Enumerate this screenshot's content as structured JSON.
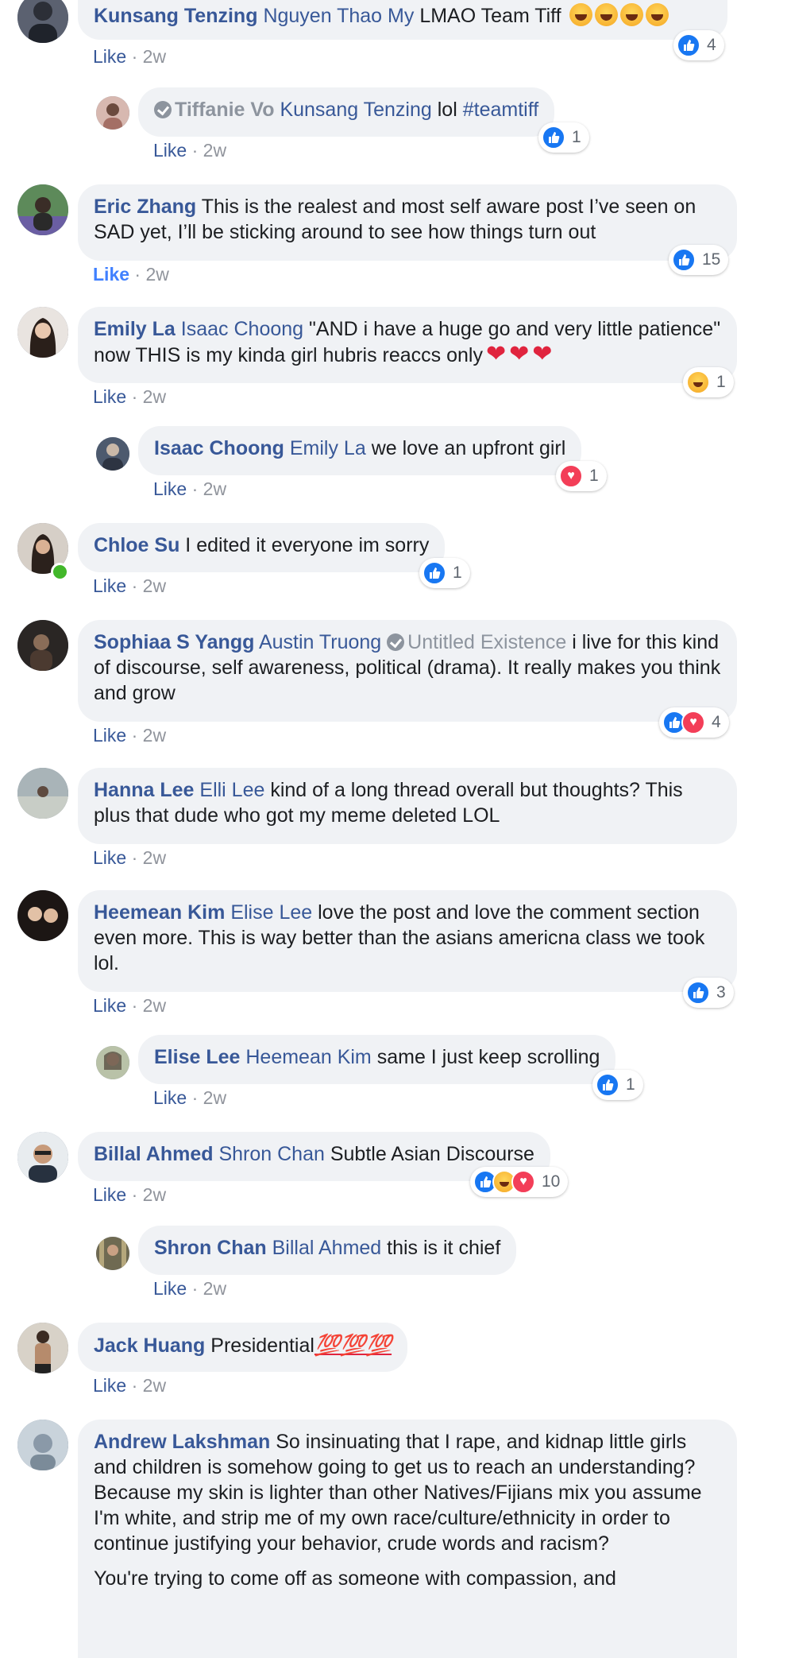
{
  "comments": [
    {
      "id": "c1",
      "author": "Kunsang Tenzing",
      "mention": "Nguyen Thao My",
      "text": "LMAO Team Tiff",
      "emoji_count": 4,
      "like_label": "Like",
      "sep": "·",
      "time": "2w",
      "reaction_count": "4",
      "reactions": [
        "like"
      ],
      "replies": [
        {
          "id": "r1",
          "muted_author": "Tiffanie Vo",
          "mention": "Kunsang Tenzing",
          "text": "lol",
          "hashtag": "#teamtiff",
          "like_label": "Like",
          "sep": "·",
          "time": "2w",
          "reaction_count": "1",
          "reactions": [
            "like"
          ]
        }
      ]
    },
    {
      "id": "c2",
      "author": "Eric Zhang",
      "text": "This is the realest and most self aware post I’ve seen on SAD yet, I’ll be sticking around to see how things turn out",
      "like_label": "Like",
      "like_active": true,
      "sep": "·",
      "time": "2w",
      "reaction_count": "15",
      "reactions": [
        "like"
      ]
    },
    {
      "id": "c3",
      "author": "Emily La",
      "mention": "Isaac Choong",
      "text": "\"AND i have a huge go and very little patience\" now THIS is my kinda girl hubris reaccs only",
      "like_label": "Like",
      "sep": "·",
      "time": "2w",
      "reaction_count": "1",
      "reactions": [
        "haha"
      ],
      "replies": [
        {
          "id": "r2",
          "author": "Isaac Choong",
          "mention": "Emily La",
          "text": "we love an upfront girl",
          "like_label": "Like",
          "sep": "·",
          "time": "2w",
          "reaction_count": "1",
          "reactions": [
            "love"
          ]
        }
      ]
    },
    {
      "id": "c4",
      "author": "Chloe Su",
      "text": "I edited it everyone im sorry",
      "online": true,
      "like_label": "Like",
      "sep": "·",
      "time": "2w",
      "reaction_count": "1",
      "reactions": [
        "like"
      ]
    },
    {
      "id": "c5",
      "author": "Sophiaa S Yangg",
      "mention": "Austin Truong",
      "muted_page": "Untitled Existence",
      "text": "i live for this kind of discourse, self awareness, political (drama). It really makes you think and grow",
      "like_label": "Like",
      "sep": "·",
      "time": "2w",
      "reaction_count": "4",
      "reactions": [
        "like",
        "love"
      ]
    },
    {
      "id": "c6",
      "author": "Hanna Lee",
      "mention": "Elli Lee",
      "text": "kind of a long thread overall but thoughts? This plus that dude who got my meme deleted LOL",
      "like_label": "Like",
      "sep": "·",
      "time": "2w"
    },
    {
      "id": "c7",
      "author": "Heemean Kim",
      "mention": "Elise Lee",
      "text": "love the post and love the comment section even more. This is way better than the asians americna class we took lol.",
      "like_label": "Like",
      "sep": "·",
      "time": "2w",
      "reaction_count": "3",
      "reactions": [
        "like"
      ],
      "replies": [
        {
          "id": "r3",
          "author": "Elise Lee",
          "mention": "Heemean Kim",
          "text": "same I just keep scrolling",
          "like_label": "Like",
          "sep": "·",
          "time": "2w",
          "reaction_count": "1",
          "reactions": [
            "like"
          ]
        }
      ]
    },
    {
      "id": "c8",
      "author": "Billal Ahmed",
      "mention": "Shron Chan",
      "text": "Subtle Asian Discourse",
      "like_label": "Like",
      "sep": "·",
      "time": "2w",
      "reaction_count": "10",
      "reactions": [
        "like",
        "haha",
        "love"
      ],
      "replies": [
        {
          "id": "r4",
          "author": "Shron Chan",
          "mention": "Billal Ahmed",
          "text": "this is it chief",
          "like_label": "Like",
          "sep": "·",
          "time": "2w"
        }
      ]
    },
    {
      "id": "c9",
      "author": "Jack Huang",
      "text": "Presidential",
      "emoji": "💯💯💯",
      "like_label": "Like",
      "sep": "·",
      "time": "2w"
    },
    {
      "id": "c10",
      "author": "Andrew Lakshman",
      "text": "So insinuating that I rape, and kidnap little girls and children is somehow going to get us to reach an understanding? Because my skin is lighter than other Natives/Fijians mix you assume I'm white, and strip me of my own race/culture/ethnicity in order to continue justifying your behavior, crude words and racism?",
      "text2": "You're trying to come off as someone with compassion, and"
    }
  ]
}
